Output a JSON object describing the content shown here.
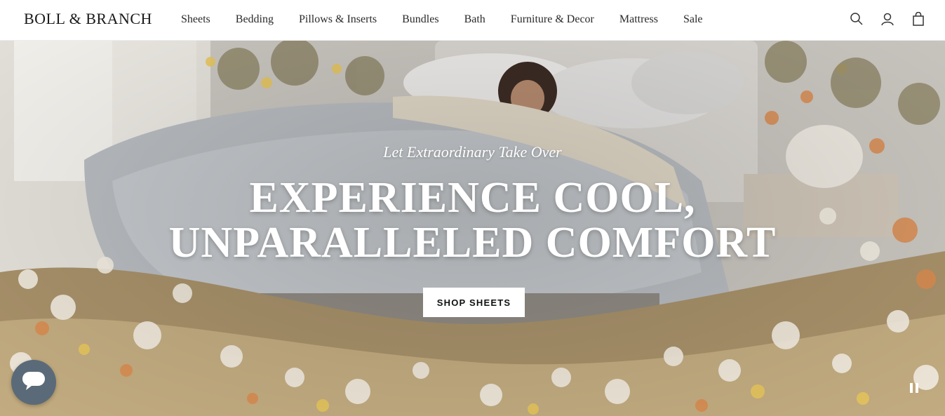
{
  "header": {
    "logo": "BOLL & BRANCH",
    "nav": [
      {
        "label": "Sheets"
      },
      {
        "label": "Bedding"
      },
      {
        "label": "Pillows & Inserts"
      },
      {
        "label": "Bundles"
      },
      {
        "label": "Bath"
      },
      {
        "label": "Furniture & Decor"
      },
      {
        "label": "Mattress"
      },
      {
        "label": "Sale"
      }
    ],
    "icons": [
      "search-icon",
      "account-icon",
      "cart-icon"
    ]
  },
  "hero": {
    "subtitle": "Let Extraordinary Take Over",
    "title_line1": "EXPERIENCE COOL,",
    "title_line2": "UNPARALLELED COMFORT",
    "cta_label": "SHOP SHEETS"
  },
  "widgets": {
    "chat_icon": "chat-bubble-icon",
    "pause_icon": "pause-icon"
  },
  "colors": {
    "header_bg": "#ffffff",
    "text_dark": "#1a1a1a",
    "chat_bg": "#5b6a78",
    "cta_bg": "#ffffff"
  }
}
